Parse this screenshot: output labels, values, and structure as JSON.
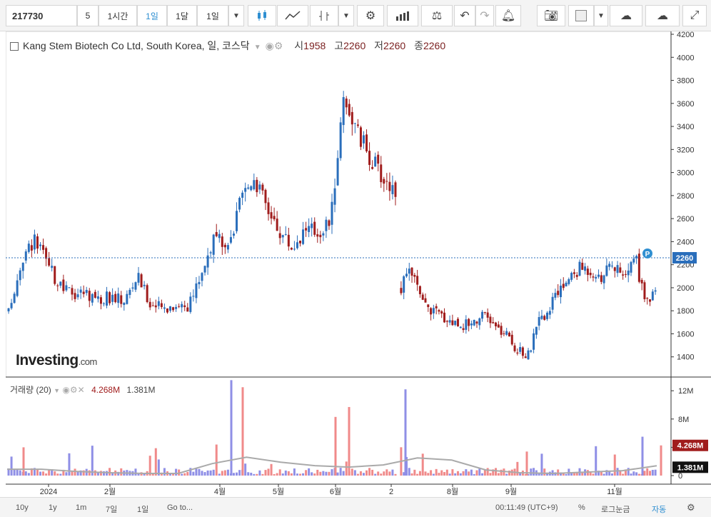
{
  "toolbar": {
    "symbol": "217730",
    "interval_5": "5",
    "interval_1h": "1시간",
    "interval_1d": "1일",
    "interval_1mo": "1달",
    "range_1d": "1일"
  },
  "legend": {
    "title": "Kang Stem Biotech Co Ltd, South Korea, 일, 코스닥",
    "open_label": "시",
    "open": "1958",
    "high_label": "고",
    "high": "2260",
    "low_label": "저",
    "low": "2260",
    "close_label": "종",
    "close": "2260"
  },
  "volume_legend": {
    "label": "거래량 (20)",
    "value": "4.268M",
    "ma": "1.381M"
  },
  "price_badge": "2260",
  "event_marker": "P",
  "vol_badge": "4.268M",
  "vol_ma_badge": "1.381M",
  "logo": {
    "main": "Investing",
    "dot": ".com"
  },
  "bottom": {
    "ranges": [
      "10y",
      "1y",
      "1m",
      "7일",
      "1일"
    ],
    "goto": "Go to...",
    "time": "00:11:49 (UTC+9)",
    "percent": "%",
    "log": "로그눈금",
    "auto": "자동"
  },
  "colors": {
    "up": "#2a6ebb",
    "down": "#a01c1c",
    "up_vol": "#8f8fe6",
    "down_vol": "#f08a8a",
    "ma": "#aaaaaa",
    "last_price": "#2a6ebb"
  },
  "chart_data": {
    "type": "candlestick",
    "price_axis": {
      "min": 1200,
      "max": 4200,
      "ticks": [
        1400,
        1600,
        1800,
        2000,
        2200,
        2400,
        2600,
        2800,
        3000,
        3200,
        3400,
        3600,
        3800,
        4000,
        4200
      ]
    },
    "volume_axis": {
      "ticks": [
        "0",
        "4M",
        "8M",
        "12M"
      ],
      "tick_values": [
        0,
        4,
        8,
        12
      ]
    },
    "x_tick_labels": [
      "2024",
      "2월",
      "4월",
      "5월",
      "6월",
      "2",
      "8월",
      "9월",
      "11월"
    ],
    "last_price": 2260,
    "segments": [
      {
        "bars": 135,
        "path": [
          1780,
          2240,
          2420,
          2200,
          2000,
          1950,
          1960,
          1900,
          1920,
          1890,
          2100,
          1860,
          1820,
          1860,
          1840,
          2150,
          2450,
          2300,
          2750,
          2980,
          2700,
          2500,
          2350,
          2520,
          2480,
          2600,
          3700,
          3350,
          3150,
          2950,
          2850
        ]
      },
      {
        "bars": 95,
        "path": [
          2000,
          2150,
          1860,
          1800,
          1750,
          1700,
          1680,
          1730,
          1750,
          1650,
          1580,
          1450,
          1420,
          1700,
          1820,
          1980,
          2100,
          2180,
          2150,
          2100,
          2200,
          2050,
          2300,
          1900,
          1940
        ]
      }
    ],
    "volume_ma": [
      0.9,
      0.9,
      0.6,
      0.4,
      0.3,
      0.3,
      1.7,
      2.6,
      1.9,
      1.4,
      1.2,
      1.5,
      2.5,
      2.2,
      0.8,
      0.4,
      0.3,
      0.5,
      0.7,
      1.381
    ],
    "volume_spikes_M": [
      4,
      13.5,
      12.5,
      9.7,
      8.3,
      12.2,
      3.4,
      5.5,
      4.268
    ]
  }
}
